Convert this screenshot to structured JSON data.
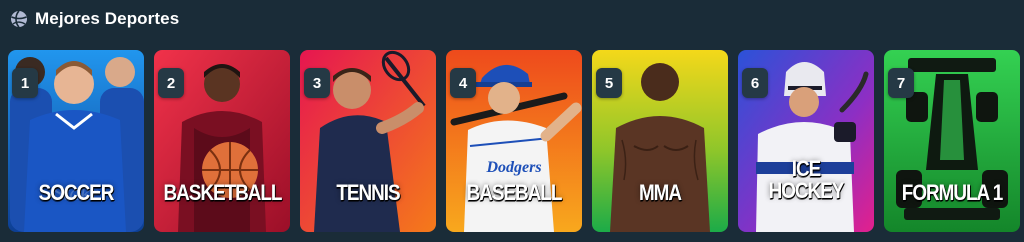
{
  "header": {
    "title": "Mejores Deportes",
    "icon": "sports-ball-icon"
  },
  "cards": [
    {
      "rank": "1",
      "label": "SOCCER",
      "theme": {
        "top": "#1c8be0",
        "bottom": "#0b3d8c"
      }
    },
    {
      "rank": "2",
      "label": "BASKETBALL",
      "theme": {
        "top": "#e8263f",
        "bottom": "#a3112a"
      }
    },
    {
      "rank": "3",
      "label": "TENNIS",
      "theme": {
        "top": "#e8194a",
        "bottom": "#f36a1c"
      }
    },
    {
      "rank": "4",
      "label": "BASEBALL",
      "theme": {
        "top": "#f05a1e",
        "bottom": "#f7a21b"
      }
    },
    {
      "rank": "5",
      "label": "MMA",
      "theme": {
        "top": "#f2d41c",
        "bottom": "#1fb34a"
      }
    },
    {
      "rank": "6",
      "label": "ICE\nHOCKEY",
      "theme": {
        "top": "#2e4fd6",
        "bottom": "#e0218a"
      }
    },
    {
      "rank": "7",
      "label": "FORMULA 1",
      "theme": {
        "top": "#2ecb4b",
        "bottom": "#158a2c"
      }
    }
  ]
}
